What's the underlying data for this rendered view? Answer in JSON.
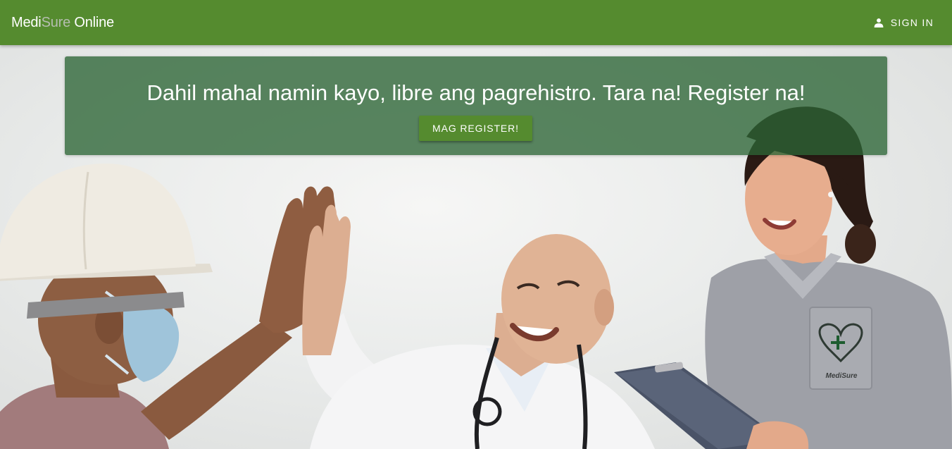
{
  "header": {
    "brand": {
      "part1": "Medi",
      "part2": "Sure",
      "part3": " Online"
    },
    "signin": {
      "icon": "person-icon",
      "label": "SIGN IN"
    }
  },
  "banner": {
    "headline": "Dahil mahal namin kayo, libre ang pagrehistro. Tara na! Register na!",
    "button_label": "MAG REGISTER!"
  },
  "hero": {
    "scrubs_logo_text": "MediSure"
  },
  "colors": {
    "appbar": "#558b2f",
    "banner": "#2c6434",
    "button": "#558b2f",
    "brand_muted": "#b5bdb0"
  }
}
